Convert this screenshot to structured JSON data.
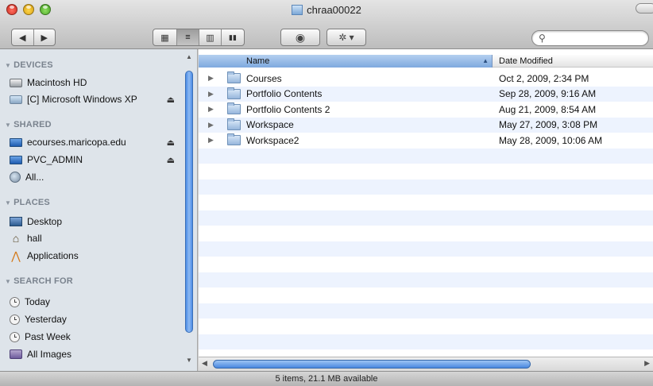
{
  "window": {
    "title": "chraa00022"
  },
  "toolbar": {
    "back_glyph": "◀",
    "forward_glyph": "▶",
    "view_icons_glyph": "▦",
    "view_list_glyph": "≡",
    "view_columns_glyph": "▥",
    "view_coverflow_glyph": "▮▮",
    "quicklook_glyph": "◉",
    "action_glyph": "✲ ▾",
    "search": {
      "value": "",
      "placeholder": ""
    }
  },
  "sidebar": {
    "sections": [
      {
        "label": "DEVICES"
      },
      {
        "label": "SHARED"
      },
      {
        "label": "PLACES"
      },
      {
        "label": "SEARCH FOR"
      }
    ],
    "devices": [
      {
        "label": "Macintosh HD",
        "icon": "hard-drive-icon"
      },
      {
        "label": "[C] Microsoft Windows XP",
        "icon": "windows-drive-icon",
        "eject": true
      }
    ],
    "shared": [
      {
        "label": "ecourses.maricopa.edu",
        "icon": "server-icon",
        "eject": true
      },
      {
        "label": "PVC_ADMIN",
        "icon": "server-icon",
        "eject": true
      },
      {
        "label": "All...",
        "icon": "network-icon"
      }
    ],
    "places": [
      {
        "label": "Desktop",
        "icon": "desktop-icon"
      },
      {
        "label": "hall",
        "icon": "home-icon"
      },
      {
        "label": "Applications",
        "icon": "applications-icon"
      }
    ],
    "search_for": [
      {
        "label": "Today",
        "icon": "clock-icon"
      },
      {
        "label": "Yesterday",
        "icon": "clock-icon"
      },
      {
        "label": "Past Week",
        "icon": "clock-icon"
      },
      {
        "label": "All Images",
        "icon": "images-icon"
      }
    ],
    "eject_glyph": "⏏"
  },
  "list": {
    "columns": {
      "name": "Name",
      "date": "Date Modified"
    },
    "rows": [
      {
        "name": "Courses",
        "date": "Oct 2, 2009, 2:34 PM"
      },
      {
        "name": "Portfolio Contents",
        "date": "Sep 28, 2009, 9:16 AM"
      },
      {
        "name": "Portfolio Contents 2",
        "date": "Aug 21, 2009, 8:54 AM"
      },
      {
        "name": "Workspace",
        "date": "May 27, 2009, 3:08 PM"
      },
      {
        "name": "Workspace2",
        "date": "May 28, 2009, 10:06 AM"
      }
    ]
  },
  "status": {
    "text": "5 items, 21.1 MB available"
  }
}
